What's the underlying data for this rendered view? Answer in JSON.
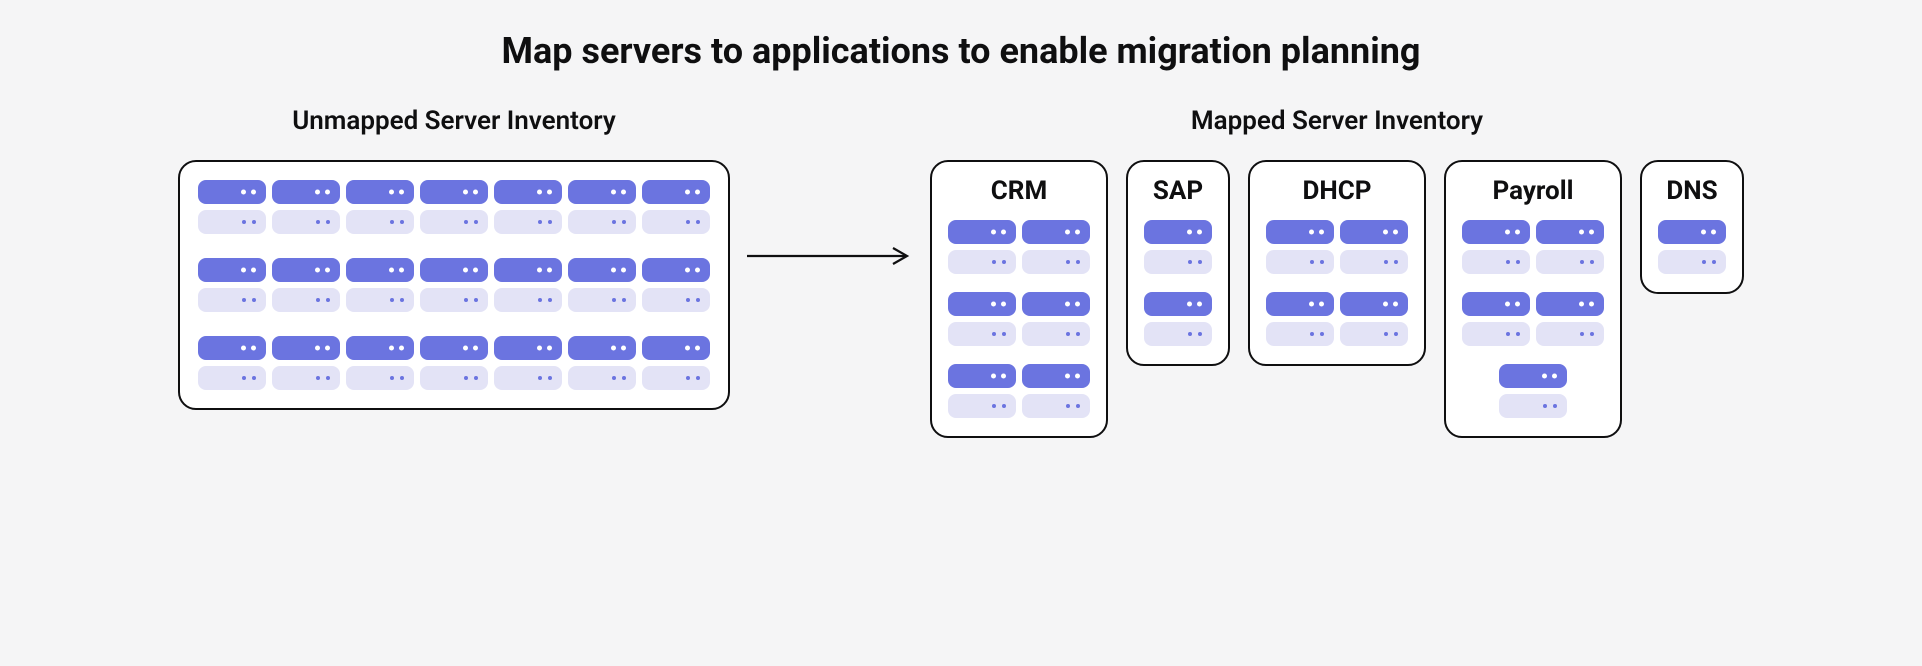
{
  "title": "Map servers to applications to enable migration planning",
  "left_heading": "Unmapped Server Inventory",
  "right_heading": "Mapped Server Inventory",
  "unmapped": {
    "rows": 3,
    "cols": 7
  },
  "groups": [
    {
      "name": "CRM",
      "servers": 6,
      "cols": 2
    },
    {
      "name": "SAP",
      "servers": 2,
      "cols": 1
    },
    {
      "name": "DHCP",
      "servers": 4,
      "cols": 2
    },
    {
      "name": "Payroll",
      "servers": 5,
      "cols": 2
    },
    {
      "name": "DNS",
      "servers": 1,
      "cols": 1
    }
  ],
  "colors": {
    "server_dark": "#6b74e0",
    "server_light": "#e3e3f6",
    "panel_border": "#0f0f10",
    "page_bg": "#f5f5f6"
  }
}
